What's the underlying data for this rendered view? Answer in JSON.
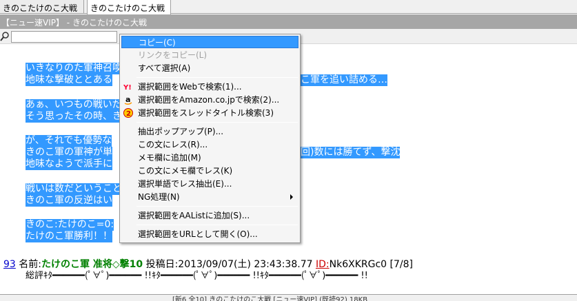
{
  "tabs": [
    {
      "label": "きのこたけのこ大戦"
    },
    {
      "label": "きのこたけのこ大戦"
    }
  ],
  "window": {
    "title": "【ニュー速VIP】 - きのこたけのこ大戦"
  },
  "search": {
    "value": "",
    "placeholder": ""
  },
  "post": {
    "lines": [
      "いきなりのた軍神召喚",
      "地味な撃破ととある",
      "あぁ、いつもの戦いだ",
      "そう思ったその時、き",
      "が、それでも優勢な",
      "きのこ軍の軍神が単",
      "地味なようで派手に",
      "戦いは数だということ",
      "きのこ軍の反逆はい",
      "きのこ:たけのこ=0:",
      "たけのこ軍勝利！！"
    ],
    "right_fragments": [
      "こ軍を追い詰める…",
      "回)数には勝てず、撃沈"
    ]
  },
  "response": {
    "number": "93",
    "name_label": "名前:",
    "name": "たけのこ軍 准将◇撃10",
    "posted_label": "投稿日:",
    "date": "2013/09/07(土) 23:43:38.77",
    "id_label": "ID:",
    "id_value": "Nk6XKRGc0",
    "count": "[7/8]",
    "aa": "総評ｷﾀ━━━━━━(ﾟ∀ﾟ)━━━━━━ !!ｷﾀ━━━━━━(ﾟ∀ﾟ)━━━━━━ !!ｷﾀ━━━━━━(ﾟ∀ﾟ)━━━━━━ !!"
  },
  "status": {
    "text": "[新6 全10] きのこたけのこ大戦 [ニュー速VIP] (既読92) 18KB"
  },
  "context_menu": {
    "items": [
      {
        "label": "コピー(C)"
      },
      {
        "label": "リンクをコピー(L)"
      },
      {
        "label": "すべて選択(A)"
      },
      {
        "label": "選択範囲をWebで検索(1)..."
      },
      {
        "label": "選択範囲をAmazon.co.jpで検索(2)..."
      },
      {
        "label": "選択範囲をスレッドタイトル検索(3)"
      },
      {
        "label": "抽出ポップアップ(P)..."
      },
      {
        "label": "この文にレス(R)..."
      },
      {
        "label": "メモ欄に追加(M)"
      },
      {
        "label": "この文にメモ欄でレス(K)"
      },
      {
        "label": "選択単語でレス抽出(E)..."
      },
      {
        "label": "NG処理(N)"
      },
      {
        "label": "選択範囲をAAListに追加(S)..."
      },
      {
        "label": "選択範囲をURLとして開く(O)..."
      }
    ],
    "icons": {
      "yahoo": {
        "text": "Y!",
        "color": "#ff0033"
      },
      "amazon": {
        "text": "a",
        "color": "#000000"
      },
      "two": {
        "text": "2",
        "color": "#ff9900"
      }
    }
  },
  "colors": {
    "selection": "#3399ff",
    "name": "#008000",
    "id": "#cc0000",
    "titlebar": "#a6a6a6"
  }
}
